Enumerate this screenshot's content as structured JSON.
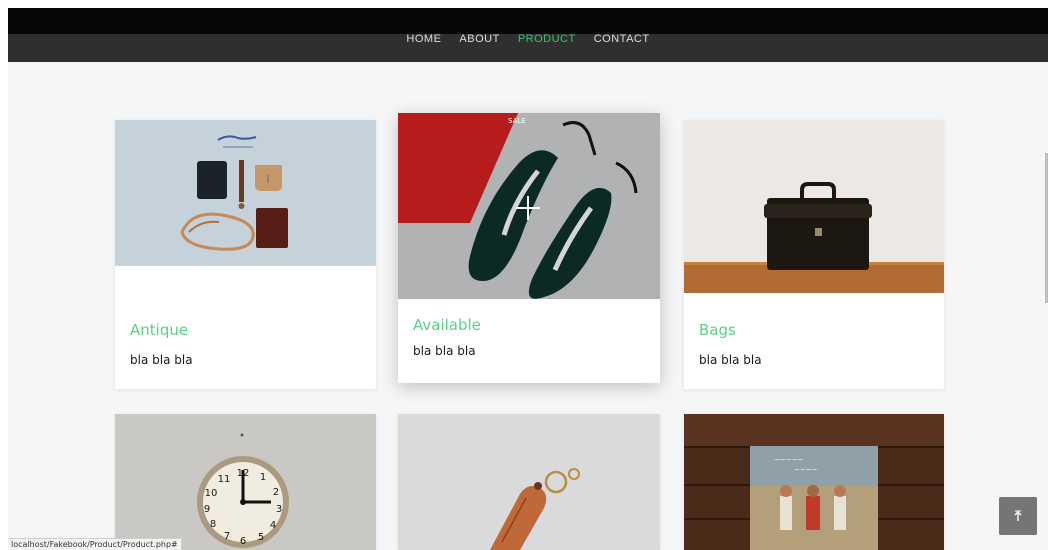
{
  "nav": {
    "items": [
      {
        "label": "HOME"
      },
      {
        "label": "ABOUT"
      },
      {
        "label": "PRODUCT"
      },
      {
        "label": "CONTACT"
      }
    ],
    "active_index": 2
  },
  "products": [
    {
      "title": "Antique",
      "description": "bla bla bla",
      "image_icon": "leather-goods-image"
    },
    {
      "title": "Available",
      "description": "bla bla bla",
      "image_icon": "shoes-image"
    },
    {
      "title": "Bags",
      "description": "bla bla bla",
      "image_icon": "briefcase-image"
    },
    {
      "image_icon": "clock-image"
    },
    {
      "image_icon": "key-holder-image"
    },
    {
      "image_icon": "record-album-image"
    }
  ],
  "status_url": "localhost/Fakebook/Product/Product.php#",
  "back_to_top": {
    "icon": "arrow-up-icon"
  },
  "colors": {
    "accent": "#5ad08a",
    "nav_active": "#35c46a",
    "nav_bg": "#2f2f2f",
    "page_bg": "#f5f6f8"
  }
}
